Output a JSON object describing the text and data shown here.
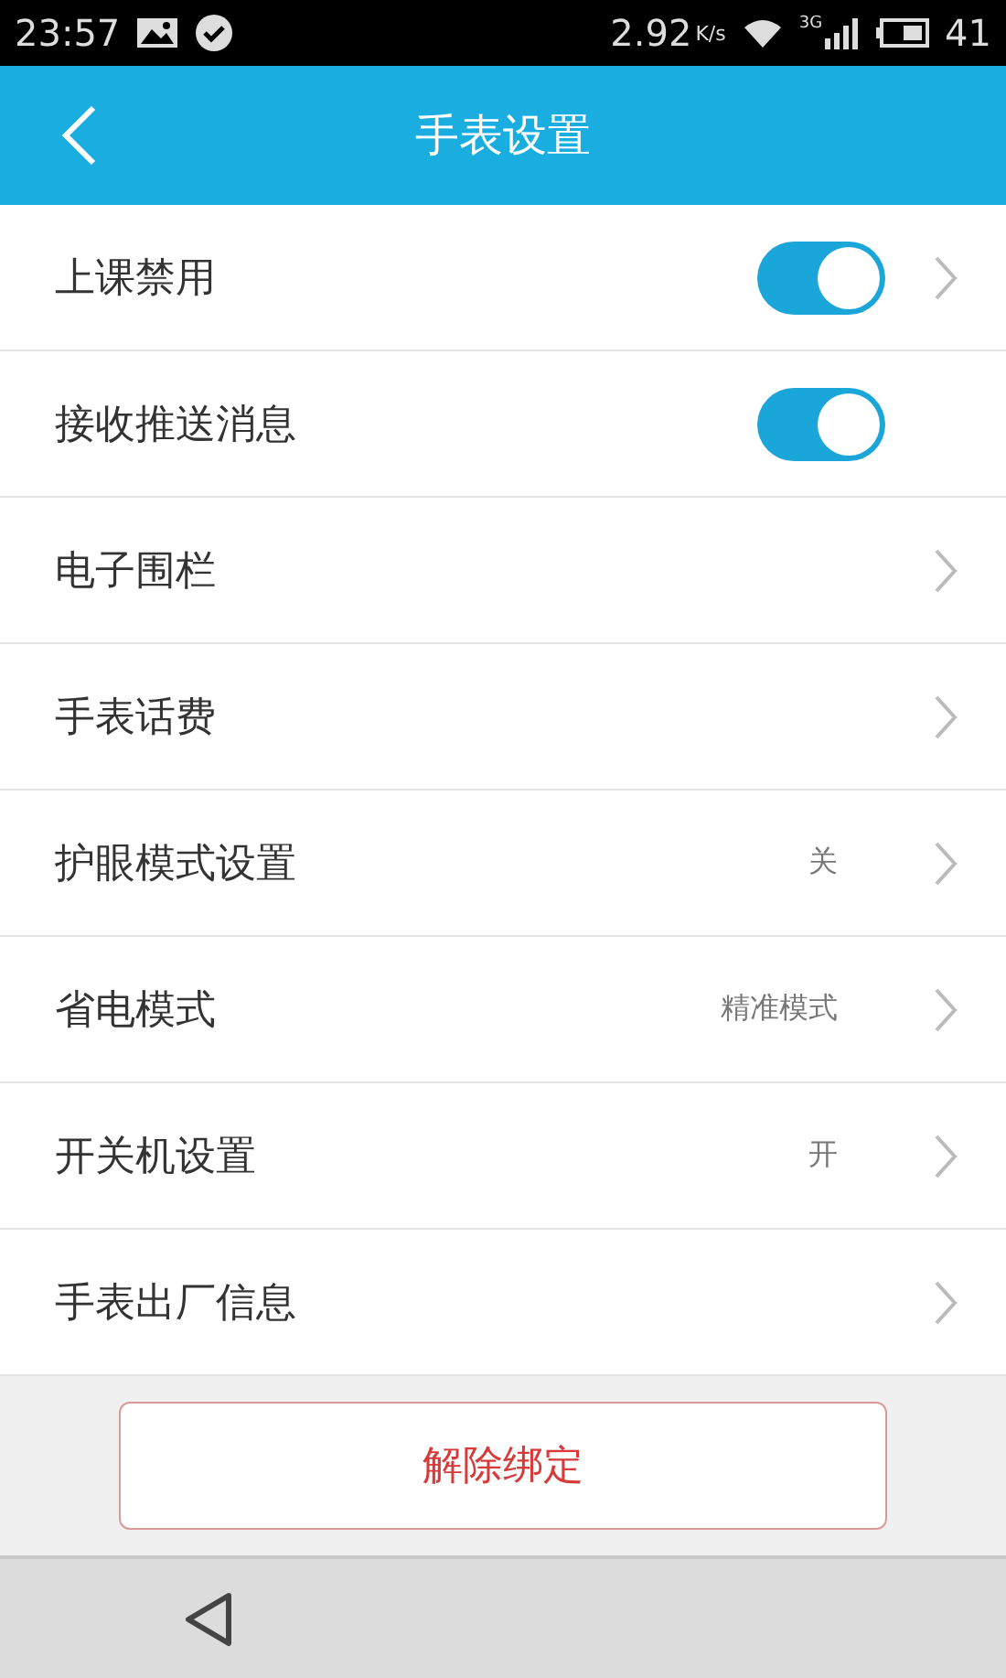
{
  "status_bar": {
    "time": "23:57",
    "speed": "2.92",
    "speed_unit": "K/s",
    "network": "3G",
    "battery": "41"
  },
  "header": {
    "title": "手表设置"
  },
  "rows": [
    {
      "label": "上课禁用",
      "kind": "switch",
      "on": true,
      "chevron": true
    },
    {
      "label": "接收推送消息",
      "kind": "switch",
      "on": true,
      "chevron": false
    },
    {
      "label": "电子围栏",
      "kind": "link",
      "chevron": true
    },
    {
      "label": "手表话费",
      "kind": "link",
      "chevron": true
    },
    {
      "label": "护眼模式设置",
      "kind": "link",
      "value": "关",
      "chevron": true
    },
    {
      "label": "省电模式",
      "kind": "link",
      "value": "精准模式",
      "chevron": true
    },
    {
      "label": "开关机设置",
      "kind": "link",
      "value": "开",
      "chevron": true
    },
    {
      "label": "手表出厂信息",
      "kind": "link",
      "chevron": true
    }
  ],
  "unbind_button": "解除绑定"
}
